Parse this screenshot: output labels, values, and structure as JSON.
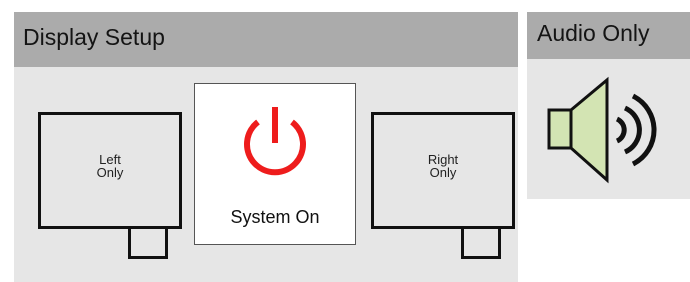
{
  "display_setup": {
    "title": "Display Setup",
    "left_monitor": {
      "line1": "Left",
      "line2": "Only"
    },
    "system_power": {
      "label": "System On",
      "icon": "power-icon",
      "icon_color": "#ee1c1c"
    },
    "right_monitor": {
      "line1": "Right",
      "line2": "Only"
    }
  },
  "audio": {
    "title": "Audio Only",
    "icon": "speaker-icon",
    "speaker_color": "#d3e4b3"
  },
  "colors": {
    "header_bg": "#ababab",
    "panel_bg": "#e6e6e6"
  }
}
